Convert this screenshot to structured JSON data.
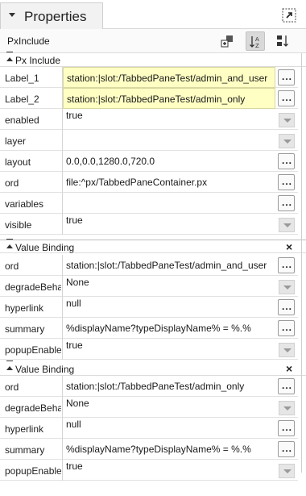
{
  "window": {
    "title": "Properties"
  },
  "toolbar": {
    "label": "PxInclude"
  },
  "icons": {
    "maximize": "maximize-icon",
    "add_slot": "add-slot-icon",
    "sort": "sort-az-icon",
    "reorder": "reorder-icon"
  },
  "colors": {
    "highlight": "#ffffc4"
  },
  "sections": [
    {
      "title": "Px Include",
      "rows": [
        {
          "name": "Label_1",
          "value": "station:|slot:/TabbedPaneTest/admin_and_user",
          "editor": "ellipsis",
          "highlight": true
        },
        {
          "name": "Label_2",
          "value": "station:|slot:/TabbedPaneTest/admin_only",
          "editor": "ellipsis",
          "highlight": true
        },
        {
          "name": "enabled",
          "value": "true",
          "editor": "dropdown"
        },
        {
          "name": "layer",
          "value": "",
          "editor": "dropdown"
        },
        {
          "name": "layout",
          "value": "0.0,0.0,1280.0,720.0",
          "editor": "ellipsis"
        },
        {
          "name": "ord",
          "value": "file:^px/TabbedPaneContainer.px",
          "editor": "ellipsis"
        },
        {
          "name": "variables",
          "value": "",
          "editor": "ellipsis"
        },
        {
          "name": "visible",
          "value": "true",
          "editor": "dropdown"
        }
      ]
    },
    {
      "title": "Value Binding",
      "rows": [
        {
          "name": "ord",
          "value": "station:|slot:/TabbedPaneTest/admin_and_user",
          "editor": "ellipsis"
        },
        {
          "name": "degradeBehav",
          "value": "None",
          "editor": "dropdown"
        },
        {
          "name": "hyperlink",
          "value": "null",
          "editor": "ellipsis"
        },
        {
          "name": "summary",
          "value": "%displayName?typeDisplayName% = %.%",
          "editor": "ellipsis"
        },
        {
          "name": "popupEnabled",
          "value": "true",
          "editor": "dropdown"
        }
      ]
    },
    {
      "title": "Value Binding",
      "rows": [
        {
          "name": "ord",
          "value": "station:|slot:/TabbedPaneTest/admin_only",
          "editor": "ellipsis"
        },
        {
          "name": "degradeBehav",
          "value": "None",
          "editor": "dropdown"
        },
        {
          "name": "hyperlink",
          "value": "null",
          "editor": "ellipsis"
        },
        {
          "name": "summary",
          "value": "%displayName?typeDisplayName% = %.%",
          "editor": "ellipsis"
        },
        {
          "name": "popupEnabled",
          "value": "true",
          "editor": "dropdown"
        }
      ]
    }
  ],
  "buttons": {
    "ellipsis": "..."
  },
  "close_glyph": "×"
}
